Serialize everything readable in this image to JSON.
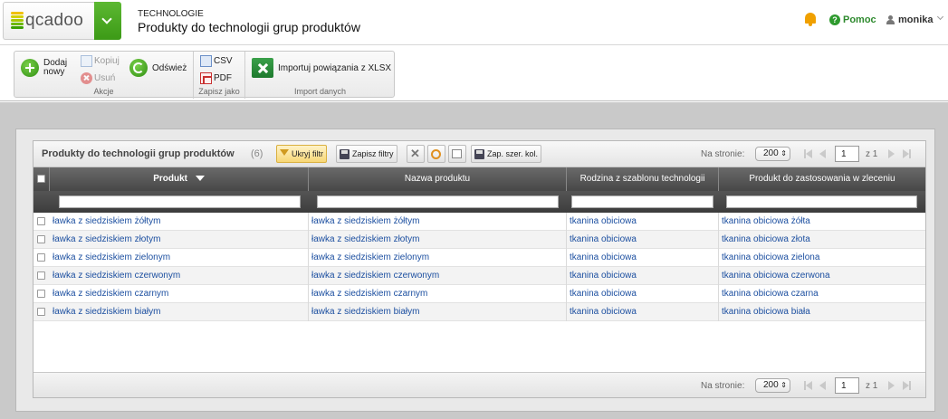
{
  "header": {
    "logo_text": "qcadoo",
    "breadcrumb_category": "TECHNOLOGIE",
    "page_title": "Produkty do technologii grup produktów",
    "help_label": "Pomoc",
    "user_name": "monika"
  },
  "ribbon": {
    "actions_group_label": "Akcje",
    "add_label_line1": "Dodaj",
    "add_label_line2": "nowy",
    "copy_label": "Kopiuj",
    "delete_label": "Usuń",
    "refresh_label": "Odśwież",
    "save_as_group_label": "Zapisz jako",
    "csv_label": "CSV",
    "pdf_label": "PDF",
    "import_group_label": "Import danych",
    "import_label": "Importuj powiązania z XLSX"
  },
  "grid": {
    "title": "Produkty do technologii grup produktów",
    "count": "(6)",
    "toolbar": {
      "hide_filter": "Ukryj filtr",
      "save_filters": "Zapisz filtry",
      "save_col_widths": "Zap. szer. kol."
    },
    "pager": {
      "per_page_label": "Na stronie:",
      "per_page_value": "200",
      "page_value": "1",
      "page_of": "z 1"
    },
    "columns": [
      "Produkt",
      "Nazwa produktu",
      "Rodzina z szablonu technologii",
      "Produkt do zastosowania w zleceniu"
    ],
    "sort_column": "Produkt",
    "sort_direction": "descending",
    "rows": [
      [
        "ławka z siedziskiem żółtym",
        "ławka z siedziskiem żółtym",
        "tkanina obiciowa",
        "tkanina obiciowa żółta"
      ],
      [
        "ławka z siedziskiem złotym",
        "ławka z siedziskiem złotym",
        "tkanina obiciowa",
        "tkanina obiciowa złota"
      ],
      [
        "ławka z siedziskiem zielonym",
        "ławka z siedziskiem zielonym",
        "tkanina obiciowa",
        "tkanina obiciowa zielona"
      ],
      [
        "ławka z siedziskiem czerwonym",
        "ławka z siedziskiem czerwonym",
        "tkanina obiciowa",
        "tkanina obiciowa czerwona"
      ],
      [
        "ławka z siedziskiem czarnym",
        "ławka z siedziskiem czarnym",
        "tkanina obiciowa",
        "tkanina obiciowa czarna"
      ],
      [
        "ławka z siedziskiem białym",
        "ławka z siedziskiem białym",
        "tkanina obiciowa",
        "tkanina obiciowa biała"
      ]
    ]
  },
  "colors": {
    "brand_green": "#3c9a16",
    "link_blue": "#1c4fa0",
    "workspace_gray": "#c9c9c9",
    "column_header": "#474747"
  },
  "icons": [
    "menu-chevron-icon",
    "bell-icon",
    "help-icon",
    "user-icon",
    "add-icon",
    "copy-icon",
    "delete-icon",
    "refresh-icon",
    "csv-icon",
    "pdf-icon",
    "xlsx-icon",
    "filter-icon",
    "save-icon",
    "clear-icon",
    "reset-icon",
    "columns-icon"
  ]
}
